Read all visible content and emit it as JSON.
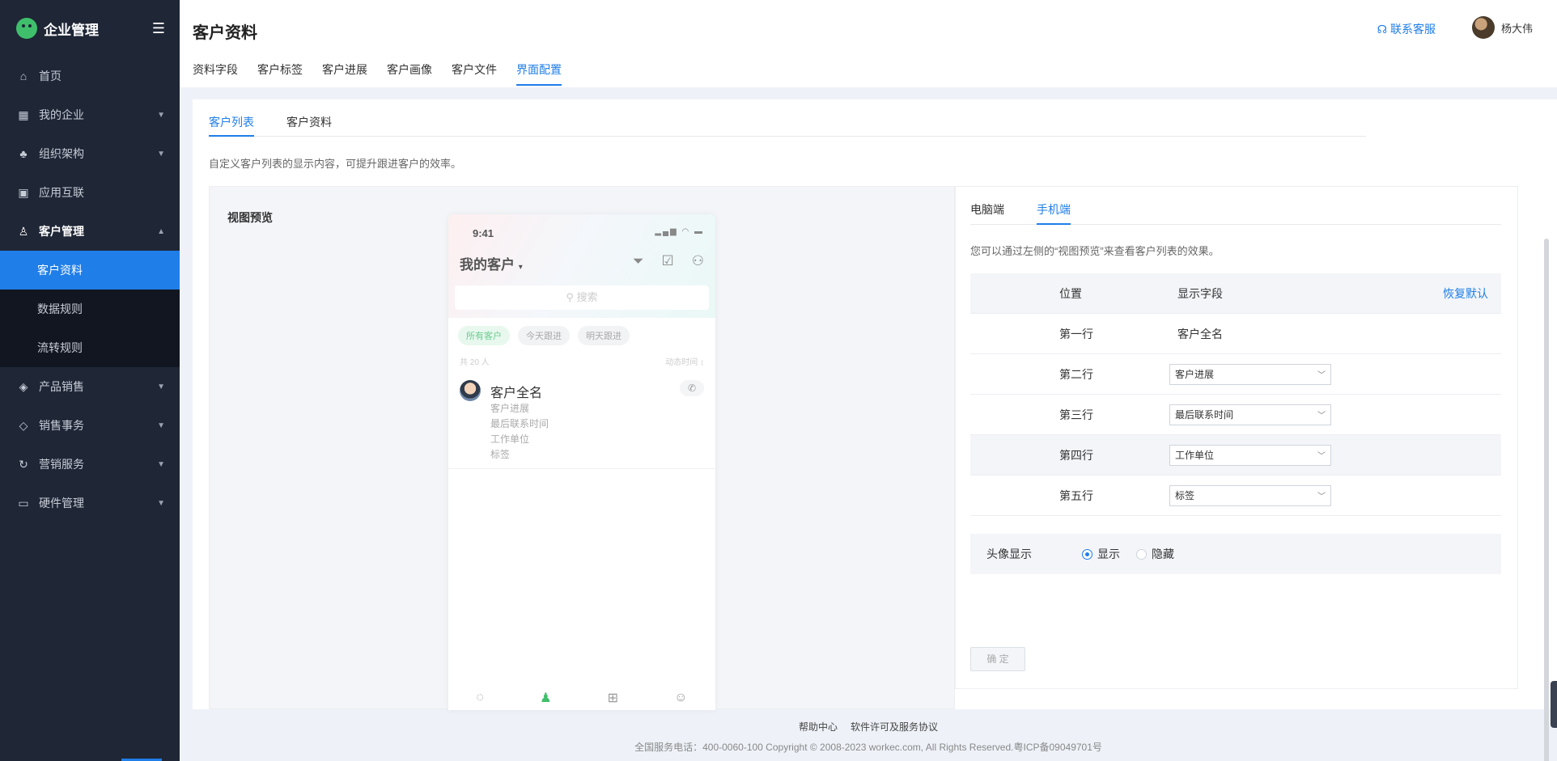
{
  "sidebar": {
    "brand": "企业管理",
    "items": [
      {
        "label": "首页",
        "icon": "home-icon"
      },
      {
        "label": "我的企业",
        "icon": "building-icon"
      },
      {
        "label": "组织架构",
        "icon": "org-chart-icon"
      },
      {
        "label": "应用互联",
        "icon": "apps-icon"
      },
      {
        "label": "客户管理",
        "icon": "user-icon"
      },
      {
        "label": "产品销售",
        "icon": "box-icon"
      },
      {
        "label": "销售事务",
        "icon": "layers-icon"
      },
      {
        "label": "营销服务",
        "icon": "marketing-icon"
      },
      {
        "label": "硬件管理",
        "icon": "hardware-icon"
      }
    ],
    "sub_items": [
      "客户资料",
      "数据规则",
      "流转规则"
    ]
  },
  "header": {
    "title": "客户资料",
    "support": "联系客服",
    "user_name": "杨大伟",
    "tabs": [
      "资料字段",
      "客户标签",
      "客户进展",
      "客户画像",
      "客户文件",
      "界面配置"
    ]
  },
  "content": {
    "sub_tabs": [
      "客户列表",
      "客户资料"
    ],
    "description": "自定义客户列表的显示内容，可提升跟进客户的效率。",
    "preview_label": "视图预览"
  },
  "phone": {
    "time": "9:41",
    "title": "我的客户",
    "search_placeholder": "搜索",
    "filters": [
      "所有客户",
      "今天跟进",
      "明天跟进"
    ],
    "count": "共 20 人",
    "sort": "动态时间",
    "customer": {
      "name": "客户全名",
      "fields": [
        "客户进展",
        "最后联系时间",
        "工作单位",
        "标签"
      ]
    }
  },
  "config": {
    "tabs": [
      "电脑端",
      "手机端"
    ],
    "description": "您可以通过左侧的“视图预览”来查看客户列表的效果。",
    "headers": {
      "position": "位置",
      "field": "显示字段",
      "restore": "恢复默认"
    },
    "rows": [
      {
        "position": "第一行",
        "field": "客户全名"
      },
      {
        "position": "第二行",
        "field": "客户进展"
      },
      {
        "position": "第三行",
        "field": "最后联系时间"
      },
      {
        "position": "第四行",
        "field": "工作单位"
      },
      {
        "position": "第五行",
        "field": "标签"
      }
    ],
    "avatar_label": "头像显示",
    "avatar_options": [
      "显示",
      "隐藏"
    ],
    "confirm": "确 定"
  },
  "footer": {
    "links": [
      "帮助中心",
      "软件许可及服务协议"
    ],
    "copyright": "全国服务电话：400-0060-100 Copyright © 2008-2023 workec.com, All Rights Reserved.粤ICP备09049701号"
  },
  "colors": {
    "accent": "#1f7ee8",
    "sidebar": "#1f2636",
    "brand_green": "#3fbf6b"
  }
}
